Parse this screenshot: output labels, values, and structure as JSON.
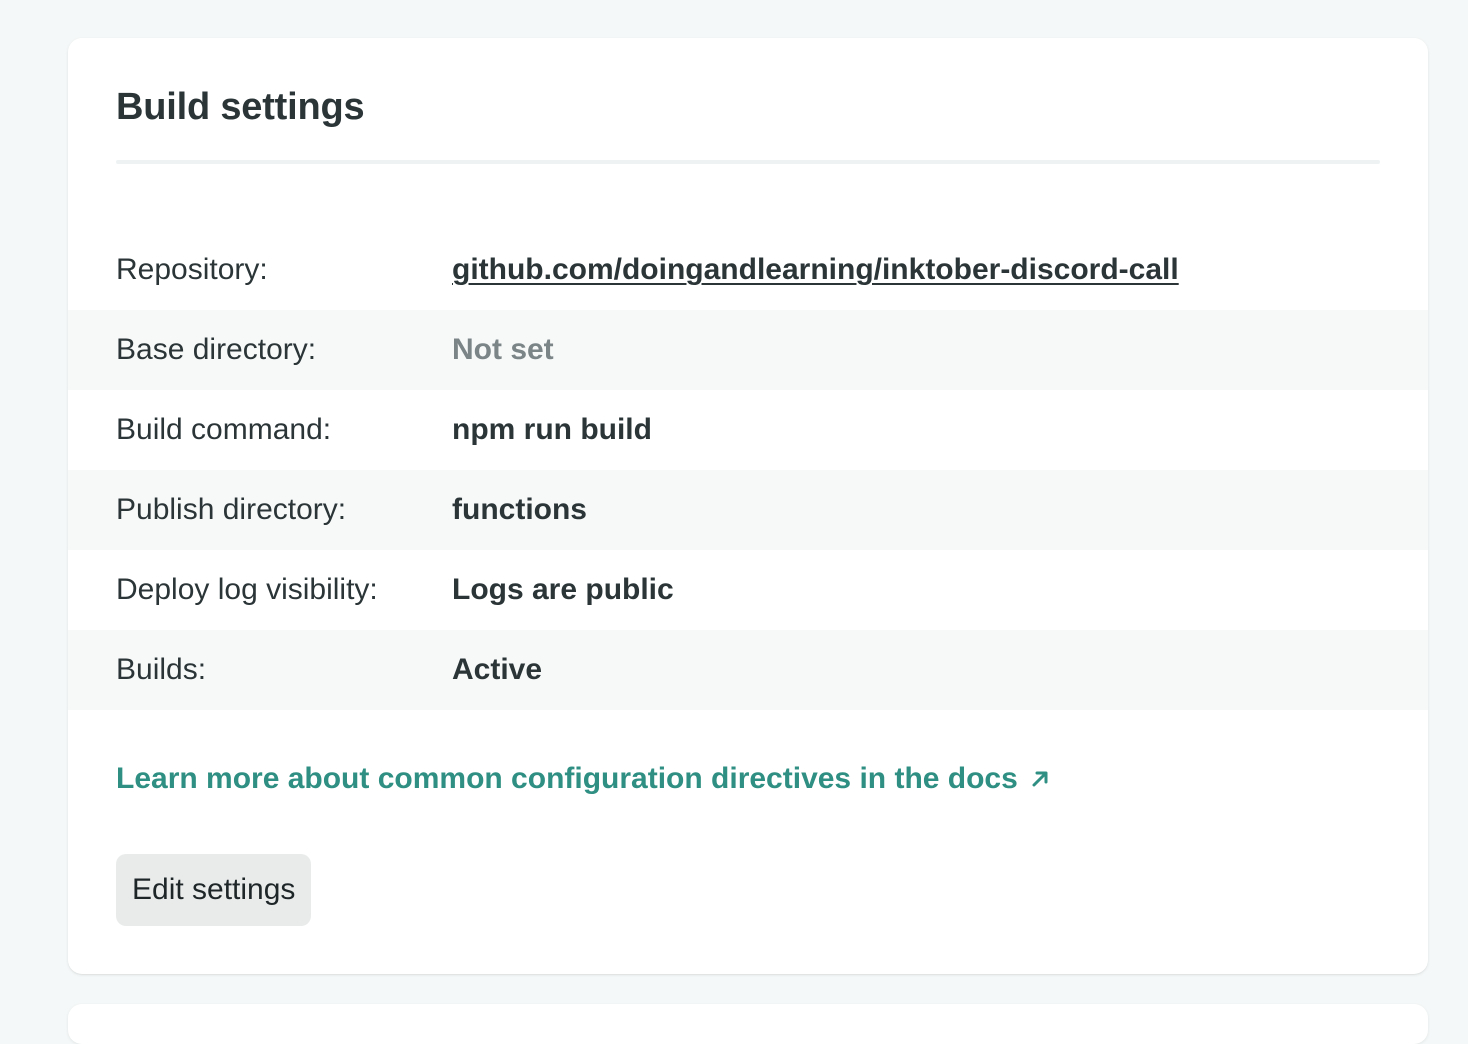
{
  "card": {
    "title": "Build settings"
  },
  "settings": [
    {
      "label": "Repository:",
      "value": "github.com/doingandlearning/inktober-discord-call"
    },
    {
      "label": "Base directory:",
      "value": "Not set"
    },
    {
      "label": "Build command:",
      "value": "npm run build"
    },
    {
      "label": "Publish directory:",
      "value": "functions"
    },
    {
      "label": "Deploy log visibility:",
      "value": "Logs are public"
    },
    {
      "label": "Builds:",
      "value": "Active"
    }
  ],
  "docs_link": {
    "text": "Learn more about common configuration directives in the docs",
    "icon": "external-arrow-icon"
  },
  "edit_button": {
    "label": "Edit settings"
  },
  "colors": {
    "background": "#f5f8f8",
    "card": "#ffffff",
    "text": "#2b3538",
    "muted": "#7b8486",
    "link": "#2e8f82",
    "button": "#e9ebeb"
  }
}
